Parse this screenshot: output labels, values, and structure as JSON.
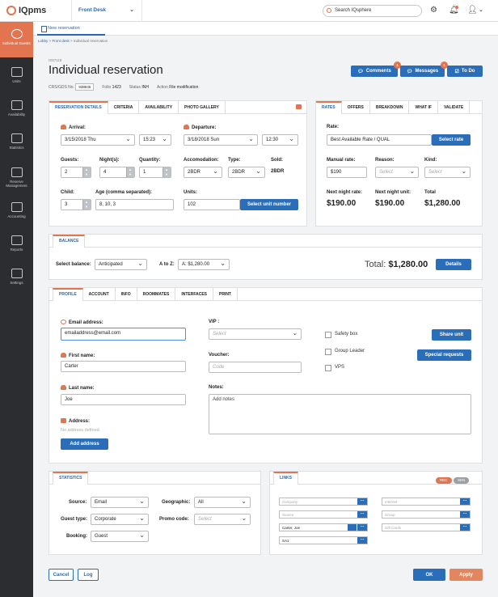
{
  "app": {
    "name": "IQpms",
    "desk": "Front Desk",
    "search_placeholder": "Search IQsphere"
  },
  "sidebar": [
    {
      "label": "Individual Guests"
    },
    {
      "label": "Units"
    },
    {
      "label": "Availability"
    },
    {
      "label": "Statistics"
    },
    {
      "label": "Reserve Management"
    },
    {
      "label": "Accounting"
    },
    {
      "label": "Reports"
    },
    {
      "label": "Settings"
    }
  ],
  "tab": {
    "label": "New reservation"
  },
  "breadcrumb": {
    "a": "Lobby",
    "b": "Front desk",
    "c": "Individual reservation",
    "sep": ">"
  },
  "header": {
    "id": "IS87118",
    "title": "Individual reservation",
    "comments": "Comments",
    "comments_badge": "1",
    "messages": "Messages",
    "messages_badge": "1",
    "todo": "To Do"
  },
  "meta": {
    "crs_label": "CRS/GDS No.",
    "crs": "938845",
    "folio_label": "Folio",
    "folio": "1423",
    "status_label": "Status",
    "status": "INH",
    "action_label": "Action",
    "action": "File modification"
  },
  "details": {
    "tabs": [
      "RESERVATION DETAILS",
      "CRITERIA",
      "AVAILABILITY",
      "PHOTO GALLERY"
    ],
    "arrival_label": "Arrival:",
    "arrival_date": "3/15/2018 Thu",
    "arrival_time": "15:23",
    "departure_label": "Departure:",
    "departure_date": "3/18/2018 Sun",
    "departure_time": "12:30",
    "guests_label": "Guests:",
    "guests": "2",
    "nights_label": "Night(s):",
    "nights": "4",
    "quantity_label": "Quantity:",
    "quantity": "1",
    "accom_label": "Accomodation:",
    "accom": "2BDR",
    "type_label": "Type:",
    "type": "2BDR",
    "sold_label": "Sold:",
    "sold": "2BDR",
    "child_label": "Child:",
    "child": "3",
    "age_label": "Age (comma separated):",
    "ages": "8, 10, 3",
    "units_label": "Units:",
    "units": "102",
    "select_unit": "Select unit number"
  },
  "rates": {
    "tabs": [
      "RATES",
      "OFFERS",
      "BREAKDOWN",
      "WHAT IF",
      "VALIDATE"
    ],
    "rate_label": "Rate:",
    "rate": "Best Available Rate / QUAL",
    "select_rate": "Select rate",
    "manual_label": "Manual rate:",
    "manual": "$190",
    "reason_label": "Reason:",
    "reason_ph": "Select",
    "kind_label": "Kind:",
    "kind_ph": "Select",
    "nnr_label": "Next night rate:",
    "nnr": "$190.00",
    "nnu_label": "Next night unit:",
    "nnu": "$190.00",
    "total_label": "Total",
    "total": "$1,280.00"
  },
  "balance": {
    "tab": "BALANCE",
    "select_label": "Select balance:",
    "select": "Anticipated",
    "atoz_label": "A to Z:",
    "atoz": "A: $1,280.00",
    "total_label": "Total:",
    "total": "$1,280.00",
    "details": "Details"
  },
  "profile": {
    "tabs": [
      "PROFILE",
      "ACCOUNT",
      "INFO",
      "ROOMMATES",
      "INTERFACES",
      "PRINT"
    ],
    "email_label": "Email address:",
    "email": "emailaddress@email.com",
    "first_label": "First name:",
    "first": "Carter",
    "last_label": "Last name:",
    "last": "Joe",
    "address_label": "Address:",
    "no_address": "No address defined.",
    "add_address": "Add address",
    "vip_label": "VIP :",
    "vip_ph": "Select",
    "voucher_label": "Voucher:",
    "voucher_ph": "Code",
    "notes_label": "Notes:",
    "notes_ph": "Add notes",
    "safety": "Safety box",
    "group": "Group Leader",
    "vps": "VPS",
    "share": "Share unit",
    "special": "Special requests"
  },
  "statistics": {
    "tab": "STATISTICS",
    "source_label": "Source:",
    "source": "Email",
    "geo_label": "Geographic:",
    "geo": "All",
    "gtype_label": "Guest type:",
    "gtype": "Corporate",
    "promo_label": "Promo code:",
    "promo_ph": "Select",
    "booking_label": "Booking:",
    "booking": "Guest"
  },
  "links": {
    "tab": "LINKS",
    "rec": "REC",
    "sen": "SEN",
    "left": [
      "Company",
      "Source",
      "Carter, Joe",
      "SA1"
    ],
    "right": [
      "Internet",
      "Group",
      "Gift Cards"
    ]
  },
  "footer": {
    "cancel": "Cancel",
    "log": "Log",
    "ok": "OK",
    "apply": "Apply"
  }
}
